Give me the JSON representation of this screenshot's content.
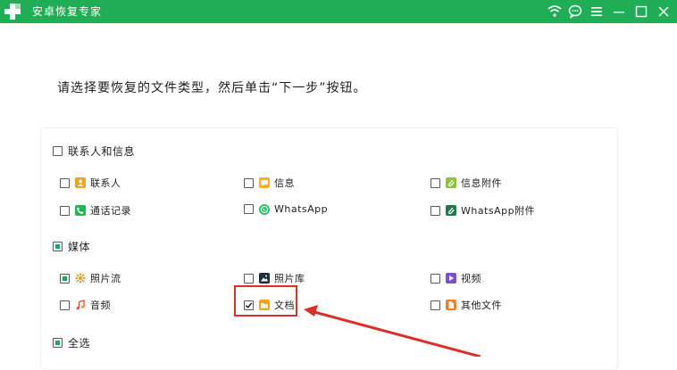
{
  "app": {
    "title": "安卓恢复专家",
    "colors": {
      "titlebar": "#1fae55",
      "accent": "#19a85f",
      "highlight": "#d9302a"
    }
  },
  "window_controls": [
    "wifi-icon",
    "chat-icon",
    "menu-icon",
    "minimize-icon",
    "maximize-icon",
    "close-icon"
  ],
  "instruction": "请选择要恢复的文件类型，然后单击“下一步”按钮。",
  "groups": {
    "contacts_messages": {
      "label": "联系人和信息",
      "state": "unchecked",
      "items": [
        {
          "label": "联系人",
          "checked": false,
          "icon": "contacts-icon"
        },
        {
          "label": "信息",
          "checked": false,
          "icon": "message-icon"
        },
        {
          "label": "信息附件",
          "checked": false,
          "icon": "attachment-icon"
        },
        {
          "label": "通话记录",
          "checked": false,
          "icon": "call-log-icon"
        },
        {
          "label": "WhatsApp",
          "checked": false,
          "icon": "whatsapp-icon"
        },
        {
          "label": "WhatsApp附件",
          "checked": false,
          "icon": "whatsapp-attachment-icon"
        }
      ]
    },
    "media": {
      "label": "媒体",
      "state": "partial",
      "items": [
        {
          "label": "照片流",
          "checked": true,
          "icon": "photo-stream-icon"
        },
        {
          "label": "照片库",
          "checked": false,
          "icon": "photo-library-icon"
        },
        {
          "label": "视频",
          "checked": false,
          "icon": "video-icon"
        },
        {
          "label": "音频",
          "checked": false,
          "icon": "audio-icon"
        },
        {
          "label": "文档",
          "checked": true,
          "icon": "document-icon"
        },
        {
          "label": "其他文件",
          "checked": false,
          "icon": "other-files-icon"
        }
      ]
    },
    "select_all": {
      "label": "全选",
      "state": "partial"
    }
  }
}
